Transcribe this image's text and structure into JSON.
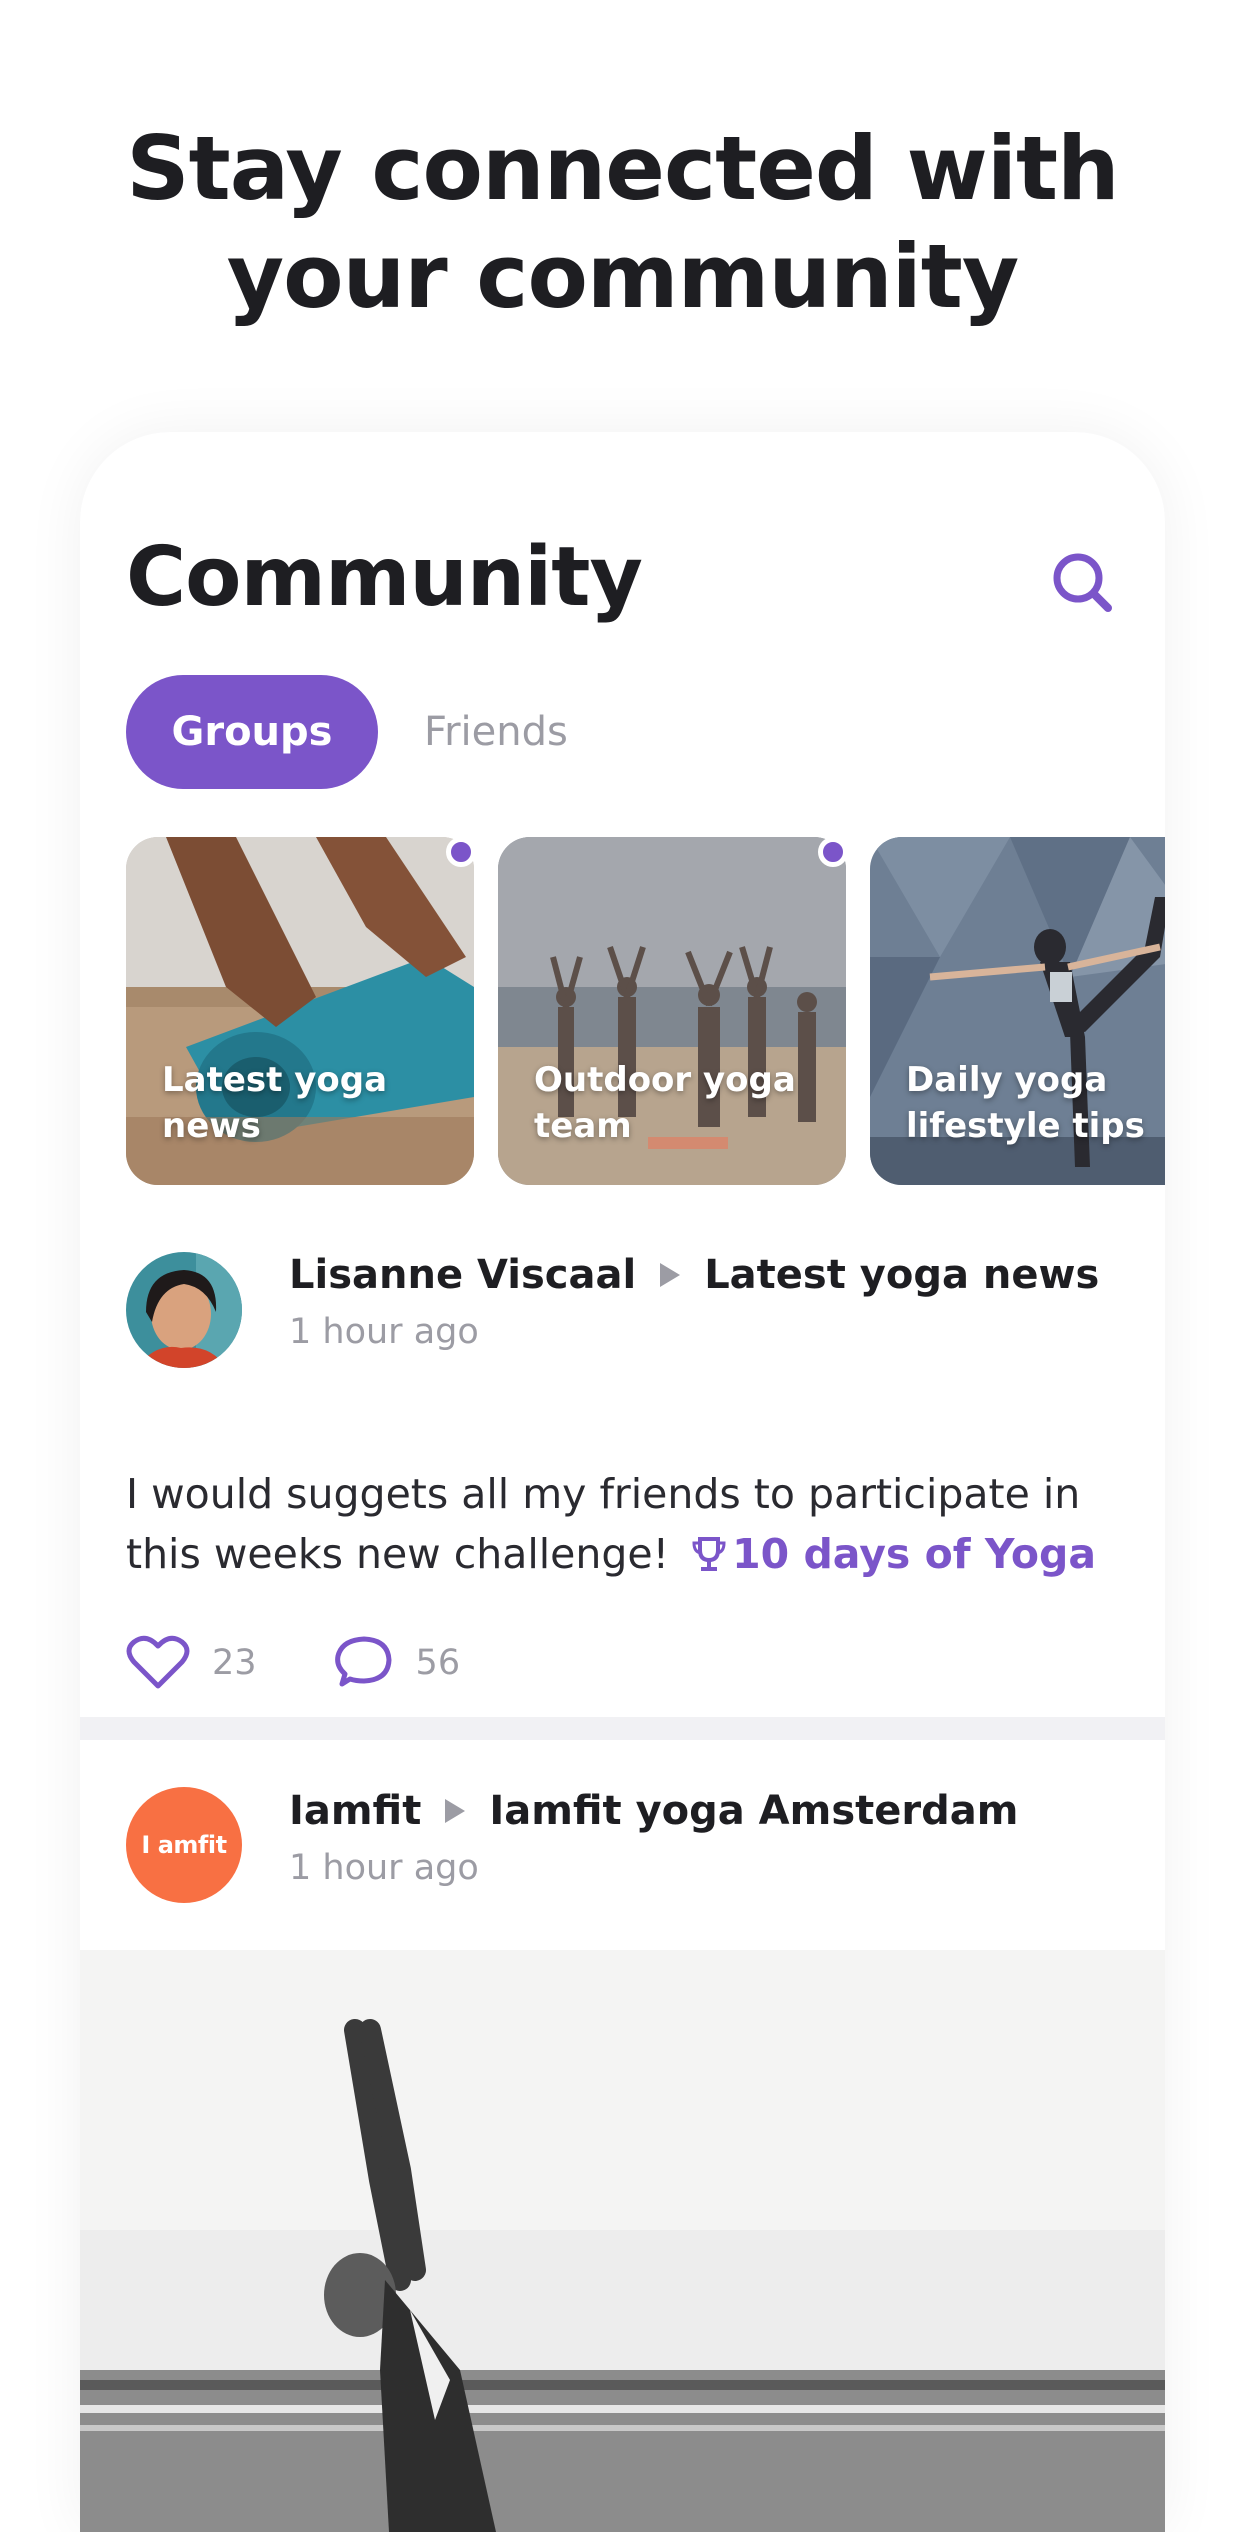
{
  "headline": {
    "line1": "Stay connected with",
    "line2": "your community"
  },
  "header": {
    "title": "Community",
    "search_icon": "search-icon"
  },
  "tabs": [
    {
      "label": "Groups",
      "active": true
    },
    {
      "label": "Friends",
      "active": false
    }
  ],
  "groups": [
    {
      "label": "Latest yoga news",
      "unread": true
    },
    {
      "label": "Outdoor yoga team",
      "unread": true
    },
    {
      "label": "Daily yoga lifestyle tips",
      "unread": false
    }
  ],
  "posts": [
    {
      "author": "Lisanne Viscaal",
      "group": "Latest yoga news",
      "time": "1 hour ago",
      "text": "I would suggets all my friends to participate in this weeks new challenge!",
      "challenge": "10 days of Yoga",
      "likes": "23",
      "comments": "56"
    },
    {
      "author": "Iamfit",
      "group": "Iamfit yoga Amsterdam",
      "time": "1 hour ago",
      "avatar_text": "I amfit"
    }
  ],
  "colors": {
    "accent": "#7b55c9",
    "iamfit": "#f87043",
    "muted": "#9c9ca4",
    "text": "#1e1e22"
  }
}
